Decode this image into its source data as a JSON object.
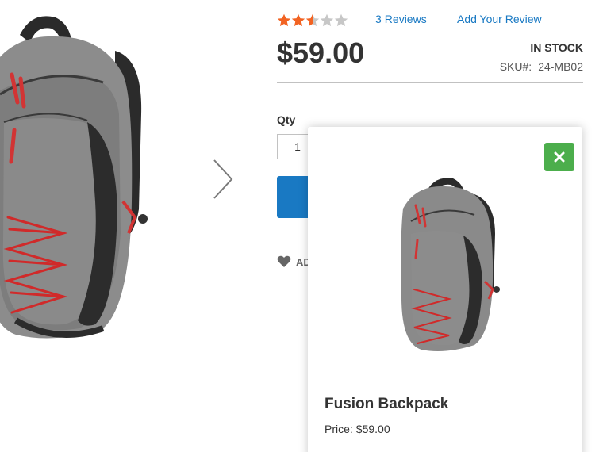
{
  "product": {
    "rating": {
      "stars_filled": 2.5,
      "stars_total": 5,
      "star_color": "#f26322",
      "star_empty_color": "#c7c7c7",
      "review_count": "3",
      "reviews_label": "Reviews",
      "add_review_label": "Add Your Review"
    },
    "price": "$59.00",
    "stock_status": "IN STOCK",
    "sku_label": "SKU#:",
    "sku_value": "24-MB02",
    "qty_label": "Qty",
    "qty_value": "1",
    "add_to_cart_label": "",
    "wishlist_label": "AD"
  },
  "gallery": {
    "image_icon": "backpack-image",
    "next_icon": "chevron-right-icon"
  },
  "popup": {
    "close_icon": "close-icon",
    "close_color": "#4cae4c",
    "image_icon": "backpack-image",
    "product_name": "Fusion Backpack",
    "price_label": "Price:",
    "price_value": "$59.00"
  },
  "colors": {
    "link": "#1979c3",
    "primary_button": "#1979c3"
  }
}
